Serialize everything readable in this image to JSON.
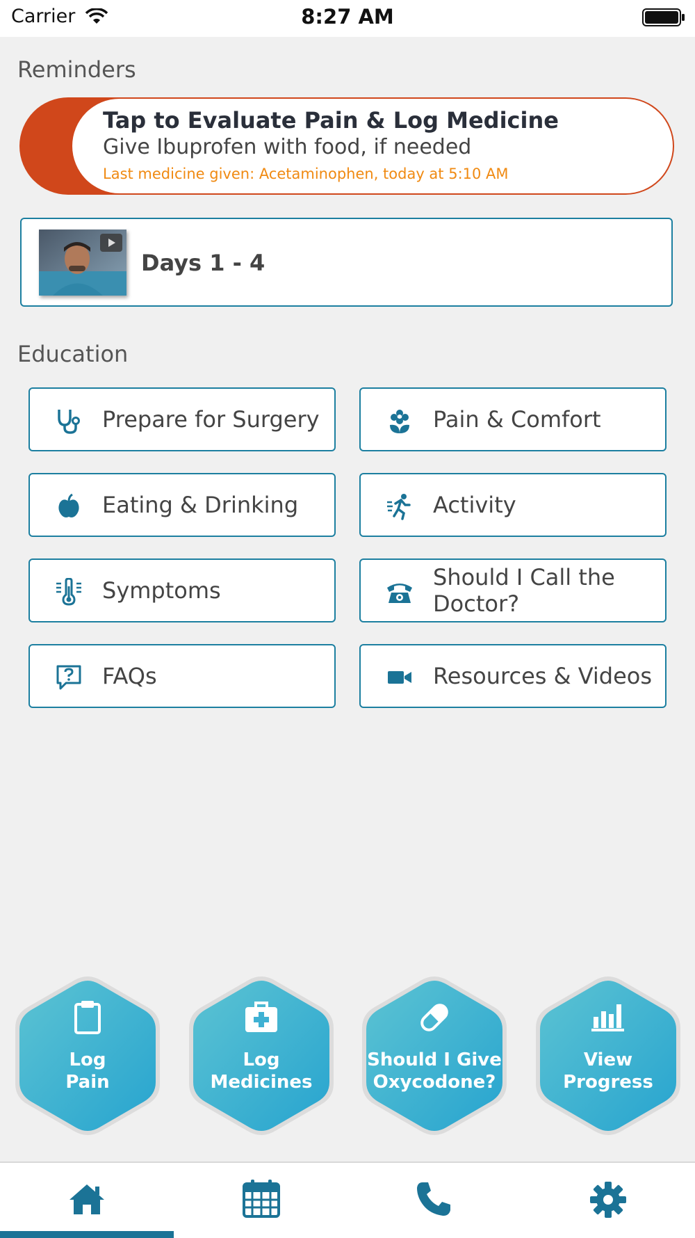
{
  "status_bar": {
    "carrier": "Carrier",
    "time": "8:27 AM"
  },
  "reminders": {
    "section_title": "Reminders",
    "title": "Tap to Evaluate Pain & Log Medicine",
    "subtitle": "Give Ibuprofen with food, if needed",
    "last_given": "Last medicine given: Acetaminophen, today at 5:10 AM"
  },
  "video": {
    "label": "Days 1 - 4"
  },
  "education": {
    "section_title": "Education",
    "items": [
      {
        "label": "Prepare for Surgery",
        "icon": "stethoscope-icon"
      },
      {
        "label": "Pain & Comfort",
        "icon": "flower-icon"
      },
      {
        "label": "Eating & Drinking",
        "icon": "apple-icon"
      },
      {
        "label": "Activity",
        "icon": "running-icon"
      },
      {
        "label": "Symptoms",
        "icon": "thermometer-icon"
      },
      {
        "label": "Should I Call the Doctor?",
        "icon": "phone-icon"
      },
      {
        "label": "FAQs",
        "icon": "question-bubble-icon"
      },
      {
        "label": "Resources & Videos",
        "icon": "video-camera-icon"
      }
    ]
  },
  "actions": [
    {
      "line1": "Log",
      "line2": "Pain",
      "icon": "clipboard-icon"
    },
    {
      "line1": "Log",
      "line2": "Medicines",
      "icon": "medical-kit-icon"
    },
    {
      "line1": "Should I Give",
      "line2": "Oxycodone?",
      "icon": "pill-icon"
    },
    {
      "line1": "View",
      "line2": "Progress",
      "icon": "bar-chart-icon"
    }
  ],
  "tabs": [
    {
      "name": "home",
      "icon": "home-icon",
      "active": true
    },
    {
      "name": "calendar",
      "icon": "calendar-icon",
      "active": false
    },
    {
      "name": "phone",
      "icon": "phone-icon",
      "active": false
    },
    {
      "name": "settings",
      "icon": "gear-icon",
      "active": false
    }
  ],
  "colors": {
    "accent": "#1b7396",
    "reminder": "#d0471b",
    "reminder_note": "#f08a12",
    "hex_gradient_start": "#5cc3d3",
    "hex_gradient_end": "#27a4cf"
  }
}
